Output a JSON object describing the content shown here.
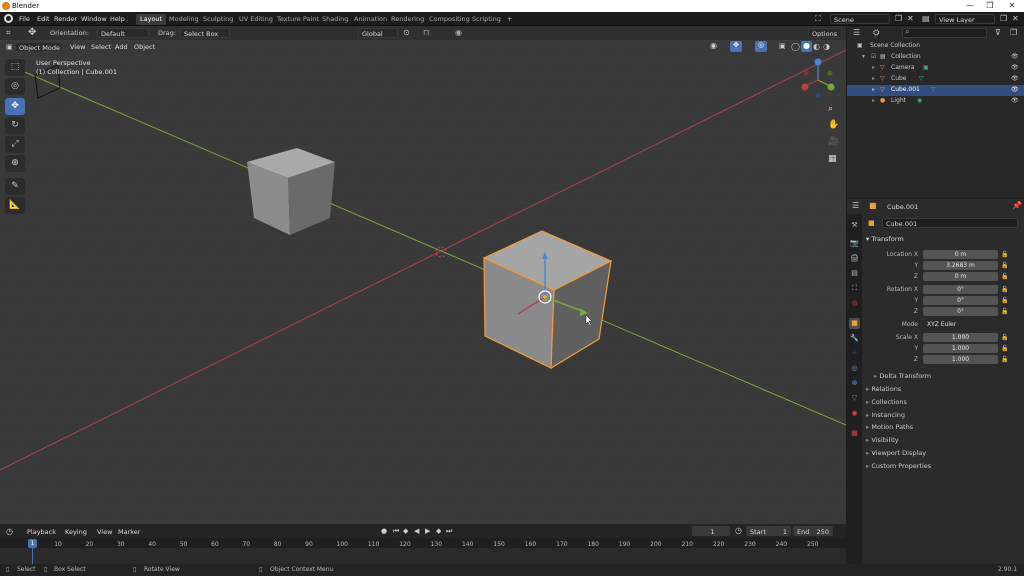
{
  "titlebar": {
    "title": "Blender",
    "minimize": "—",
    "restore": "❐",
    "close": "✕"
  },
  "menu": [
    "File",
    "Edit",
    "Render",
    "Window",
    "Help"
  ],
  "workspaces": [
    "Layout",
    "Modeling",
    "Sculpting",
    "UV Editing",
    "Texture Paint",
    "Shading",
    "Animation",
    "Rendering",
    "Compositing",
    "Scripting"
  ],
  "workspace_add": "+",
  "scene": "Scene",
  "view_layer": "View Layer",
  "toolbar": {
    "orientation_label": "Orientation:",
    "orientation_value": "Default",
    "drag_label": "Drag:",
    "drag_value": "Select Box",
    "transform_orientation": "Global",
    "options": "Options"
  },
  "viewport_header": {
    "mode": "Object Mode",
    "menus": [
      "View",
      "Select",
      "Add",
      "Object"
    ]
  },
  "viewport_info": {
    "line1": "User Perspective",
    "line2": "(1) Collection | Cube.001"
  },
  "outliner": {
    "root": "Scene Collection",
    "items": [
      {
        "name": "Collection",
        "indent": 1
      },
      {
        "name": "Camera",
        "indent": 2
      },
      {
        "name": "Cube",
        "indent": 2
      },
      {
        "name": "Cube.001",
        "indent": 2,
        "selected": true
      },
      {
        "name": "Light",
        "indent": 2
      }
    ]
  },
  "properties": {
    "object_name_header": "Cube.001",
    "object_name": "Cube.001",
    "transform_title": "Transform",
    "location_label": "Location X",
    "location": [
      "0 m",
      "3.2683 m",
      "0 m"
    ],
    "rotation_label": "Rotation X",
    "rotation": [
      "0°",
      "0°",
      "0°"
    ],
    "mode_label": "Mode",
    "mode_value": "XYZ Euler",
    "scale_label": "Scale X",
    "scale": [
      "1.000",
      "1.000",
      "1.000"
    ],
    "axis_y": "Y",
    "axis_z": "Z",
    "sections": [
      "Delta Transform",
      "Relations",
      "Collections",
      "Instancing",
      "Motion Paths",
      "Visibility",
      "Viewport Display",
      "Custom Properties"
    ]
  },
  "timeline": {
    "menus": [
      "Playback",
      "Keying",
      "View",
      "Marker"
    ],
    "current_frame": "1",
    "start_label": "Start",
    "start": "1",
    "end_label": "End",
    "end": "250",
    "ticks": [
      "1",
      "10",
      "20",
      "30",
      "40",
      "50",
      "60",
      "70",
      "80",
      "90",
      "100",
      "110",
      "120",
      "130",
      "140",
      "150",
      "160",
      "170",
      "180",
      "190",
      "200",
      "210",
      "220",
      "230",
      "240",
      "250"
    ],
    "playhead_label": "1"
  },
  "statusbar": {
    "select": "Select",
    "box_select": "Box Select",
    "rotate": "Rotate View",
    "context": "Object Context Menu",
    "version": "2.90.1"
  },
  "colors": {
    "selection": "#f29d38",
    "active_tab": "#4772b3",
    "x_axis": "#b3404e",
    "y_axis": "#7aa83a",
    "z_axis": "#4a86d4"
  }
}
